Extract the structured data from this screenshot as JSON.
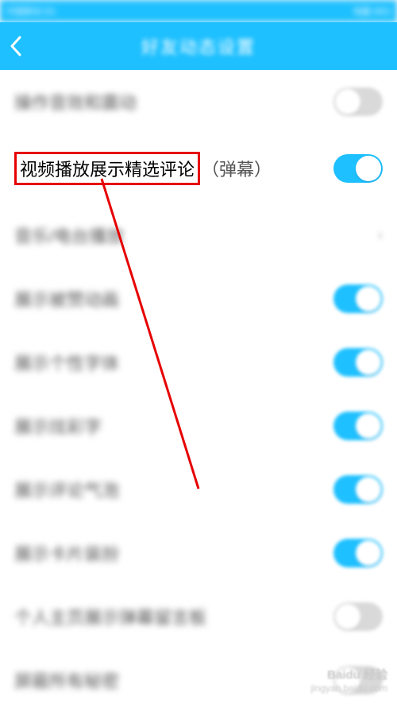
{
  "statusBar": {
    "left": "中国移动 5G",
    "right": "电量 68%"
  },
  "header": {
    "title": "好友动态设置"
  },
  "rows": {
    "r0": {
      "label": "操作音效和震动",
      "on": false
    },
    "r1": {
      "label": "视频播放展示精选评论",
      "suffix": "（弹幕）",
      "on": true
    },
    "r2": {
      "label": "音乐/电台播放"
    },
    "r3": {
      "label": "展示被赞动画",
      "on": true
    },
    "r4": {
      "label": "展示个性字体",
      "on": true
    },
    "r5": {
      "label": "展示炫彩字",
      "on": true
    },
    "r6": {
      "label": "展示评论气泡",
      "on": true
    },
    "r7": {
      "label": "展示卡片装扮",
      "on": true
    },
    "r8": {
      "label": "个人主页展示弹幕留言板",
      "on": false
    },
    "r9": {
      "label": "屏蔽所有秘密",
      "on": false
    }
  },
  "watermark": {
    "brand": "Baidu 经验",
    "url": "jingyan.baidu.com"
  }
}
